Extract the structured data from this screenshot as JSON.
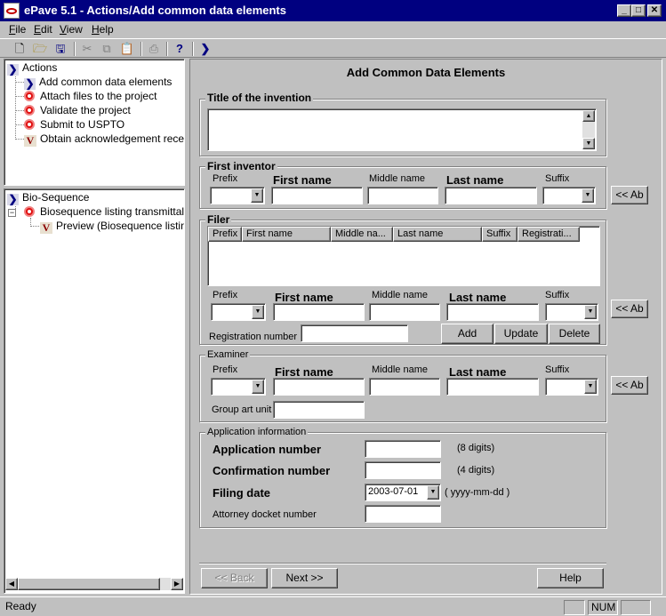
{
  "window": {
    "title": "ePave 5.1 - Actions/Add common data elements"
  },
  "menu": [
    "File",
    "Edit",
    "View",
    "Help"
  ],
  "actions_tree": {
    "root": "Actions",
    "items": [
      "Add common data elements",
      "Attach files to the project",
      "Validate the project",
      "Submit to USPTO",
      "Obtain acknowledgement receipt"
    ]
  },
  "bio_tree": {
    "root": "Bio-Sequence",
    "child": "Biosequence listing transmittal",
    "grandchild": "Preview (Biosequence listing t"
  },
  "form": {
    "heading": "Add Common Data Elements",
    "title_group": "Title of the invention",
    "first_inventor": {
      "legend": "First inventor",
      "prefix": "Prefix",
      "first": "First name",
      "middle": "Middle name",
      "last": "Last name",
      "suffix": "Suffix",
      "copy_button": "<< Ab"
    },
    "filer": {
      "legend": "Filer",
      "columns": [
        "Prefix",
        "First name",
        "Middle na...",
        "Last name",
        "Suffix",
        "Registrati..."
      ],
      "prefix": "Prefix",
      "first": "First name",
      "middle": "Middle name",
      "last": "Last name",
      "suffix": "Suffix",
      "registration_label": "Registration number",
      "add": "Add",
      "update": "Update",
      "delete": "Delete",
      "copy_button": "<< Ab"
    },
    "examiner": {
      "legend": "Examiner",
      "prefix": "Prefix",
      "first": "First name",
      "middle": "Middle name",
      "last": "Last name",
      "suffix": "Suffix",
      "group_art_unit": "Group art unit",
      "copy_button": "<< Ab"
    },
    "application": {
      "legend": "Application information",
      "app_number": "Application number",
      "app_number_hint": "(8 digits)",
      "conf_number": "Confirmation number",
      "conf_number_hint": "(4 digits)",
      "filing_date": "Filing date",
      "filing_date_value": "2003-07-01",
      "filing_date_hint": "( yyyy-mm-dd )",
      "attorney": "Attorney docket number"
    },
    "nav": {
      "back": "<< Back",
      "next": "Next >>",
      "help": "Help"
    }
  },
  "status": {
    "text": "Ready",
    "num": "NUM"
  }
}
